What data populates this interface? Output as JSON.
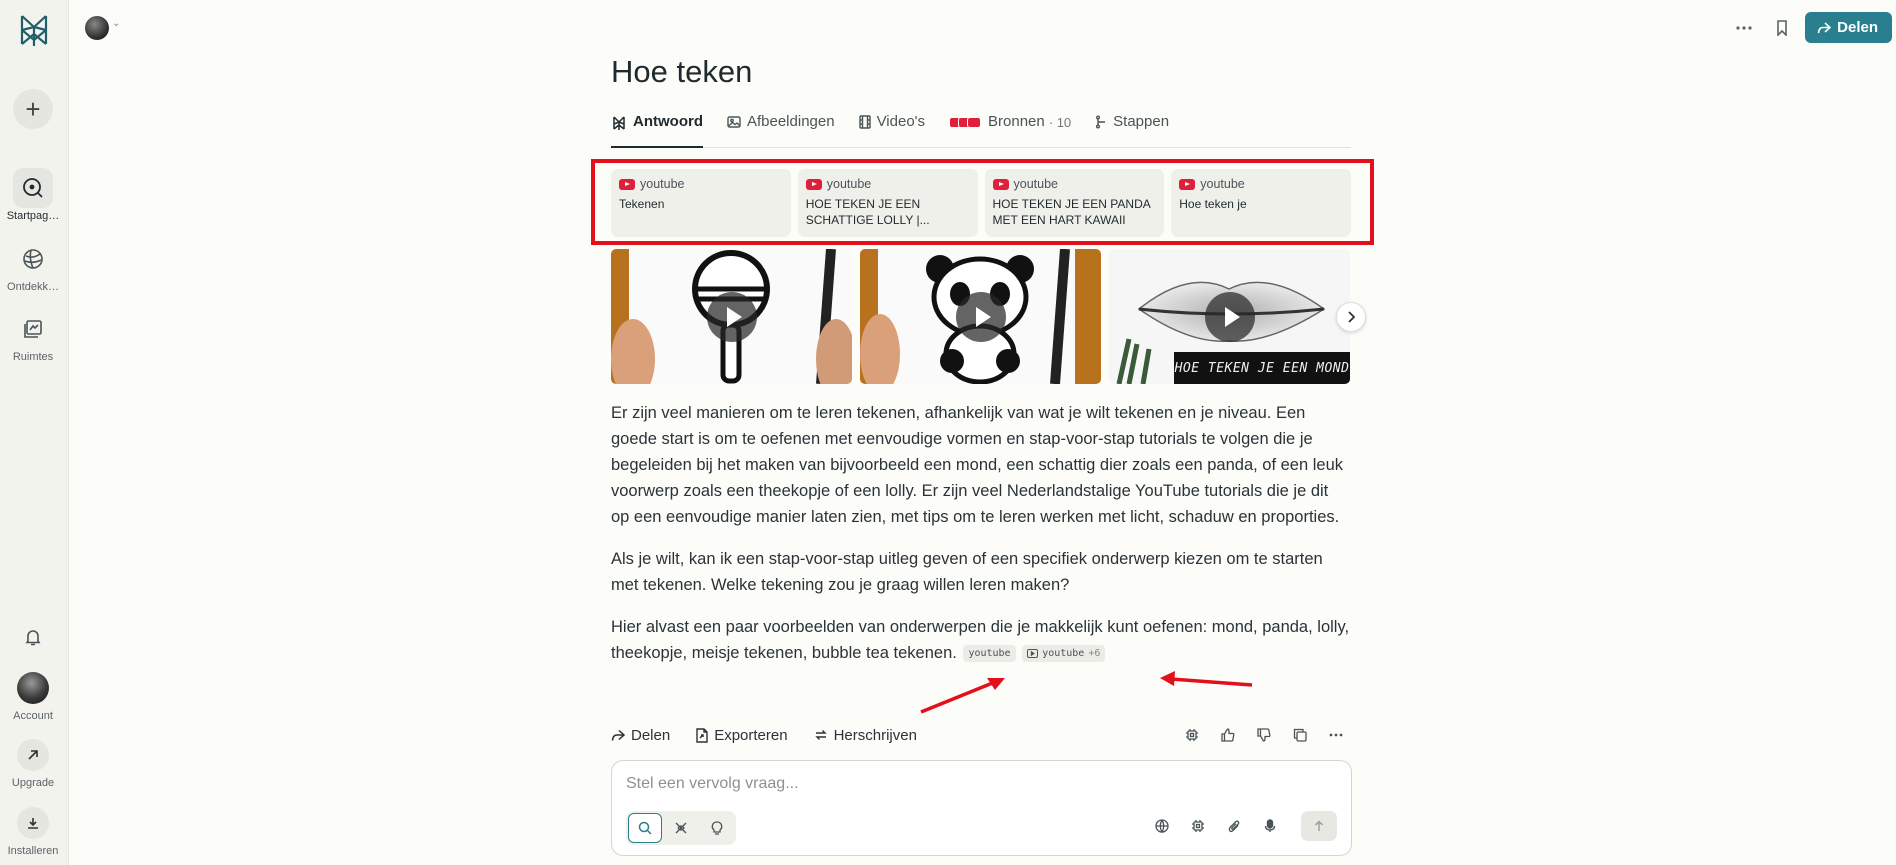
{
  "sidebar": {
    "items": [
      {
        "label": "Startpag…"
      },
      {
        "label": "Ontdekk…"
      },
      {
        "label": "Ruimtes"
      }
    ],
    "bottom": [
      {
        "label": "Account"
      },
      {
        "label": "Upgrade"
      },
      {
        "label": "Installeren"
      }
    ]
  },
  "header": {
    "share_label": "Delen"
  },
  "page": {
    "title": "Hoe teken",
    "tabs": [
      {
        "label": "Antwoord"
      },
      {
        "label": "Afbeeldingen"
      },
      {
        "label": "Video's"
      },
      {
        "label": "Bronnen",
        "count": "· 10"
      },
      {
        "label": "Stappen"
      }
    ]
  },
  "sources": [
    {
      "site": "youtube",
      "title": "Tekenen"
    },
    {
      "site": "youtube",
      "title": "HOE TEKEN JE EEN SCHATTIGE LOLLY |..."
    },
    {
      "site": "youtube",
      "title": "HOE TEKEN JE EEN PANDA MET EEN HART KAWAII"
    },
    {
      "site": "youtube",
      "title": "Hoe teken je"
    }
  ],
  "videos": [
    {
      "caption": ""
    },
    {
      "caption": ""
    },
    {
      "caption": "HOE TEKEN JE EEN MOND"
    }
  ],
  "answer": {
    "p1": "Er zijn veel manieren om te leren tekenen, afhankelijk van wat je wilt tekenen en je niveau. Een goede start is om te oefenen met eenvoudige vormen en stap-voor-stap tutorials te volgen die je begeleiden bij het maken van bijvoorbeeld een mond, een schattig dier zoals een panda, of een leuk voorwerp zoals een theekopje of een lolly. Er zijn veel Nederlandstalige YouTube tutorials die je dit op een eenvoudige manier laten zien, met tips om te leren werken met licht, schaduw en proporties.",
    "p2": "Als je wilt, kan ik een stap-voor-stap uitleg geven of een specifiek onderwerp kiezen om te starten met tekenen. Welke tekening zou je graag willen leren maken?",
    "p3": "Hier alvast een paar voorbeelden van onderwerpen die je makkelijk kunt oefenen: mond, panda, lolly, theekopje, meisje tekenen, bubble tea tekenen.",
    "cite1": "youtube",
    "cite2": "youtube",
    "cite2_more": "+6"
  },
  "actions": {
    "share": "Delen",
    "export": "Exporteren",
    "rewrite": "Herschrijven"
  },
  "followup": {
    "placeholder": "Stel een vervolg vraag..."
  },
  "colors": {
    "accent": "#2a7f8e",
    "highlight_box": "#e3101b",
    "youtube": "#e0203a"
  }
}
